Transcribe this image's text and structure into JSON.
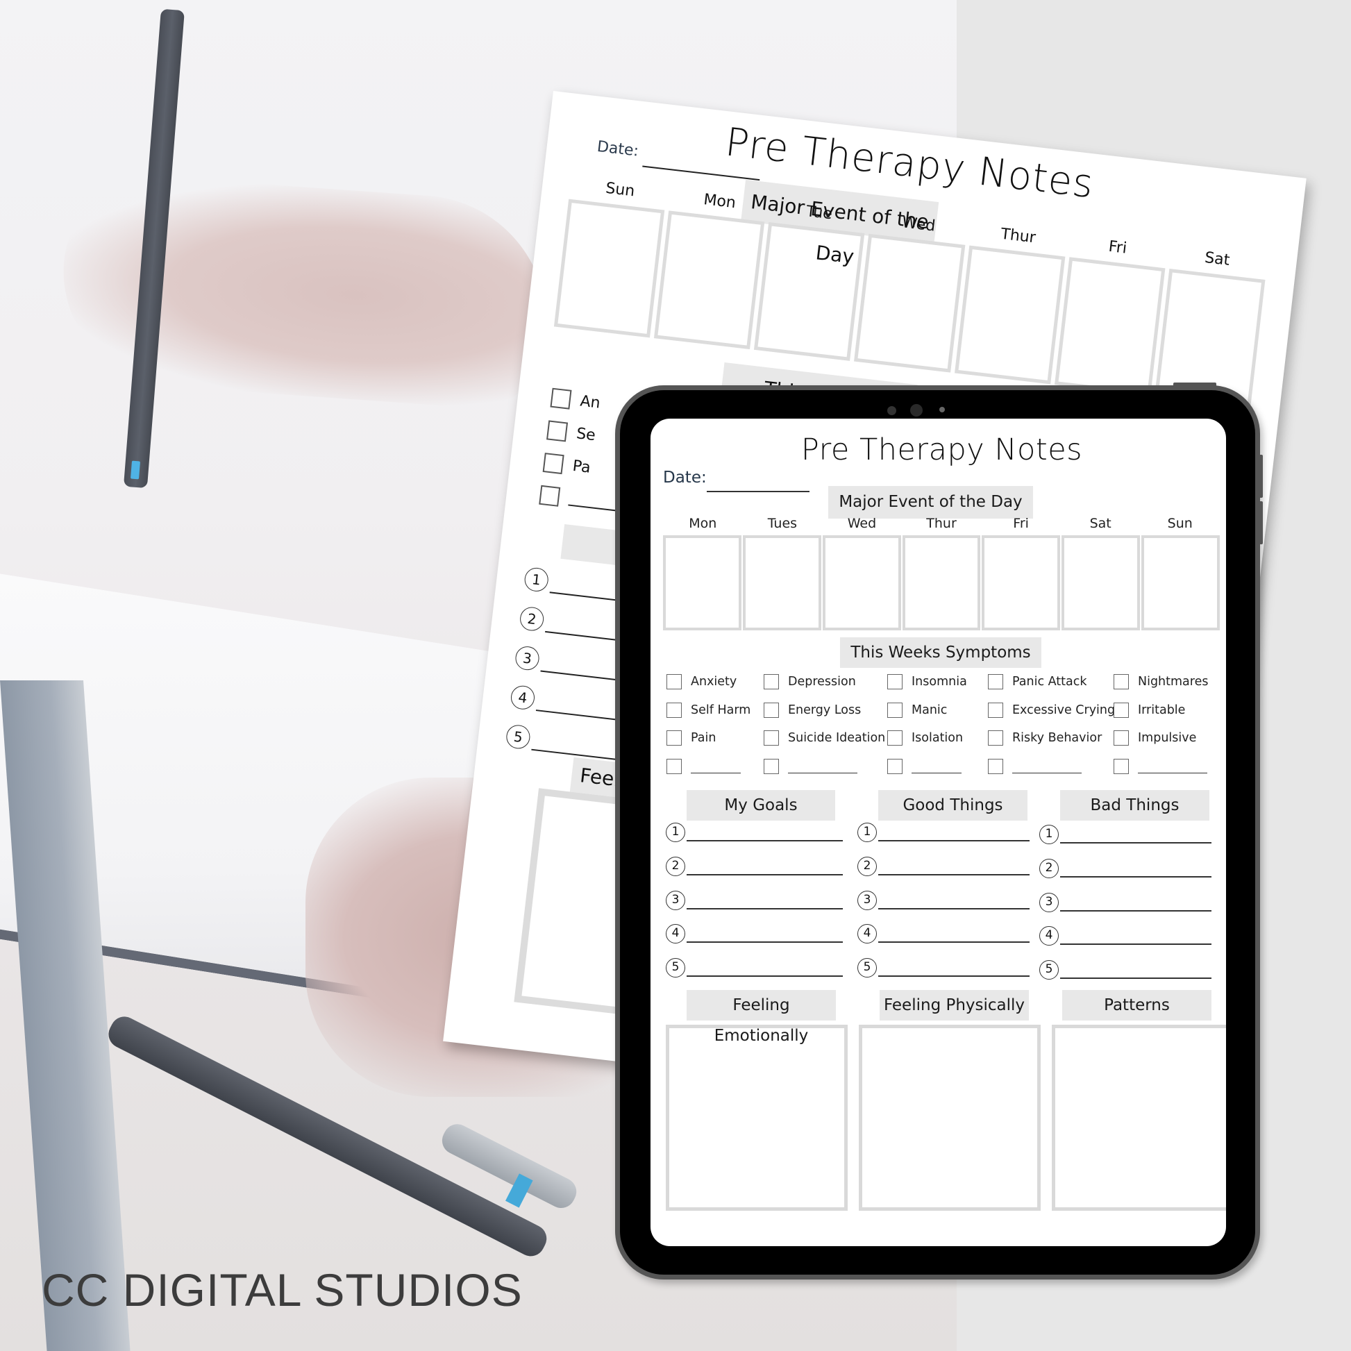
{
  "brand": {
    "name": "CC DIGITAL STUDIOS",
    "color": "#3c3c3c"
  },
  "colors": {
    "banner_bg": "#e8e8e8",
    "box_border": "#d9d9d9",
    "date_label": "#26374a",
    "tablet_frame": "#000000",
    "tablet_edge": "#555555",
    "right_panel_bg": "#e7e7e7"
  },
  "paper": {
    "title": "Pre Therapy Notes",
    "date_label": "Date:",
    "banner_major_event": "Major Event of the Day",
    "banner_symptoms": "This Weeks Symptoms",
    "days": [
      "Sun",
      "Mon",
      "Tue",
      "Wed",
      "Thur",
      "Fri",
      "Sat"
    ],
    "symptoms_visible": [
      "An",
      "Se",
      "Pa",
      ""
    ],
    "numbers": [
      "1",
      "2",
      "3",
      "4",
      "5"
    ],
    "feeling_label": "Feeling"
  },
  "tablet": {
    "title": "Pre Therapy Notes",
    "date_label": "Date:",
    "date_value": "",
    "major_event_banner": "Major Event of the Day",
    "days": [
      "Mon",
      "Tues",
      "Wed",
      "Thur",
      "Fri",
      "Sat",
      "Sun"
    ],
    "symptoms_banner": "This Weeks Symptoms",
    "symptoms": [
      [
        "Anxiety",
        "Depression",
        "Insomnia",
        "Panic Attack",
        "Nightmares"
      ],
      [
        "Self Harm",
        "Energy Loss",
        "Manic",
        "Excessive Crying",
        "Irritable"
      ],
      [
        "Pain",
        "Suicide Ideation",
        "Isolation",
        "Risky Behavior",
        "Impulsive"
      ],
      [
        "",
        "",
        "",
        "",
        ""
      ]
    ],
    "lists": [
      {
        "title": "My Goals",
        "numbers": [
          "1",
          "2",
          "3",
          "4",
          "5"
        ]
      },
      {
        "title": "Good Things",
        "numbers": [
          "1",
          "2",
          "3",
          "4",
          "5"
        ]
      },
      {
        "title": "Bad Things",
        "numbers": [
          "1",
          "2",
          "3",
          "4",
          "5"
        ]
      }
    ],
    "feelings": [
      {
        "title": "Feeling Emotionally"
      },
      {
        "title": "Feeling Physically"
      },
      {
        "title": "Patterns"
      }
    ]
  }
}
